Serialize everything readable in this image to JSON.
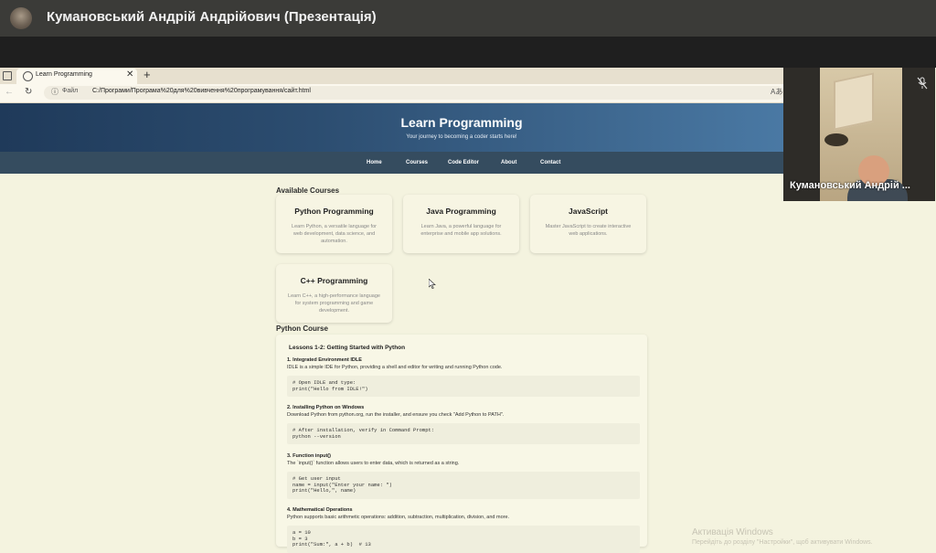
{
  "meeting": {
    "title": "Кумановський Андрій Андрійович (Презентація)",
    "participant_name": "Кумановський Андрій ..."
  },
  "browser": {
    "tab_title": "Learn Programming",
    "file_label": "Файл",
    "url": "C:/Програми/Програма%20для%20вивчення%20програмування/сайт.html",
    "reader_icon_text": "Aあ"
  },
  "site": {
    "title": "Learn Programming",
    "subtitle": "Your journey to becoming a coder starts here!",
    "nav": [
      "Home",
      "Courses",
      "Code Editor",
      "About",
      "Contact"
    ],
    "available_courses_heading": "Available Courses",
    "courses": [
      {
        "title": "Python Programming",
        "desc": "Learn Python, a versatile language for web development, data science, and automation."
      },
      {
        "title": "Java Programming",
        "desc": "Learn Java, a powerful language for enterprise and mobile app solutions."
      },
      {
        "title": "JavaScript",
        "desc": "Master JavaScript to create interactive web applications."
      },
      {
        "title": "C++ Programming",
        "desc": "Learn C++, a high-performance language for system programming and game development."
      }
    ],
    "python_course_heading": "Python Course",
    "lesson_title": "Lessons 1-2: Getting Started with Python",
    "lessons": [
      {
        "heading": "1. Integrated Environment IDLE",
        "text": "IDLE is a simple IDE for Python, providing a shell and editor for writing and running Python code.",
        "code": "# Open IDLE and type:\nprint(\"Hello from IDLE!\")"
      },
      {
        "heading": "2. Installing Python on Windows",
        "text": "Download Python from python.org, run the installer, and ensure you check \"Add Python to PATH\".",
        "code": "# After installation, verify in Command Prompt:\npython --version"
      },
      {
        "heading": "3. Function input()",
        "text": "The `input()` function allows users to enter data, which is returned as a string.",
        "code": "# Get user input\nname = input(\"Enter your name: \")\nprint(\"Hello,\", name)"
      },
      {
        "heading": "4. Mathematical Operations",
        "text": "Python supports basic arithmetic operations: addition, subtraction, multiplication, division, and more.",
        "code": "a = 10\nb = 3\nprint(\"Sum:\", a + b)  # 13"
      }
    ]
  },
  "windows_watermark": {
    "line1": "Активація Windows",
    "line2": "Перейдіть до розділу \"Настройки\", щоб активувати Windows."
  }
}
